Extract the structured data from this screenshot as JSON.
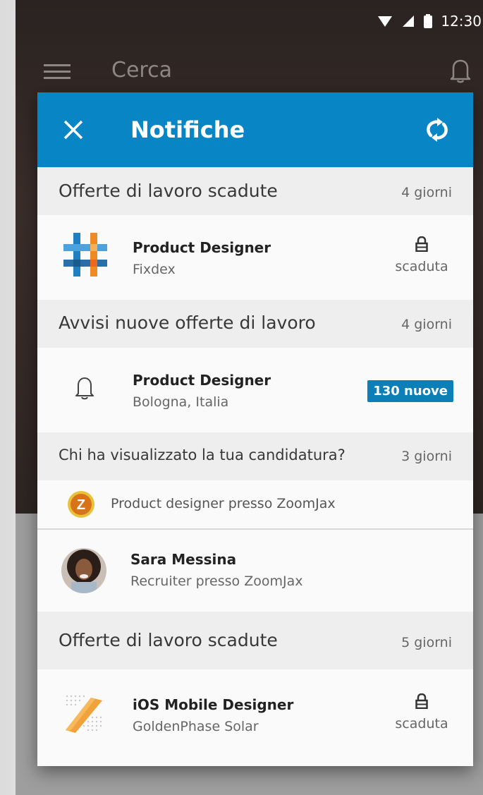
{
  "status_bar": {
    "time": "12:30"
  },
  "app_bar": {
    "search_label": "Cerca"
  },
  "panel": {
    "title": "Notifiche"
  },
  "sections": [
    {
      "label": "Offerte di lavoro scadute",
      "age": "4 giorni",
      "item": {
        "name": "Product Designer",
        "sub": "Fixdex",
        "status": "scaduta"
      }
    },
    {
      "label": "Avvisi nuove offerte di lavoro",
      "age": "4 giorni",
      "item": {
        "name": "Product Designer",
        "sub": "Bologna, Italia",
        "badge": "130 nuove"
      }
    },
    {
      "label": "Chi ha visualizzato la tua candidatura?",
      "age": "3 giorni",
      "context": "Product designer presso ZoomJax",
      "item": {
        "name": "Sara Messina",
        "sub": "Recruiter presso ZoomJax"
      }
    },
    {
      "label": "Offerte di lavoro scadute",
      "age": "5 giorni",
      "item": {
        "name": "iOS Mobile Designer",
        "sub": "GoldenPhase Solar",
        "status": "scaduta"
      }
    }
  ],
  "logos": {
    "zoomjax_letter": "Z"
  },
  "colors": {
    "header_blue": "#0885c5",
    "badge_blue": "#0b7fb6",
    "zoomjax_orange": "#d9731a"
  }
}
